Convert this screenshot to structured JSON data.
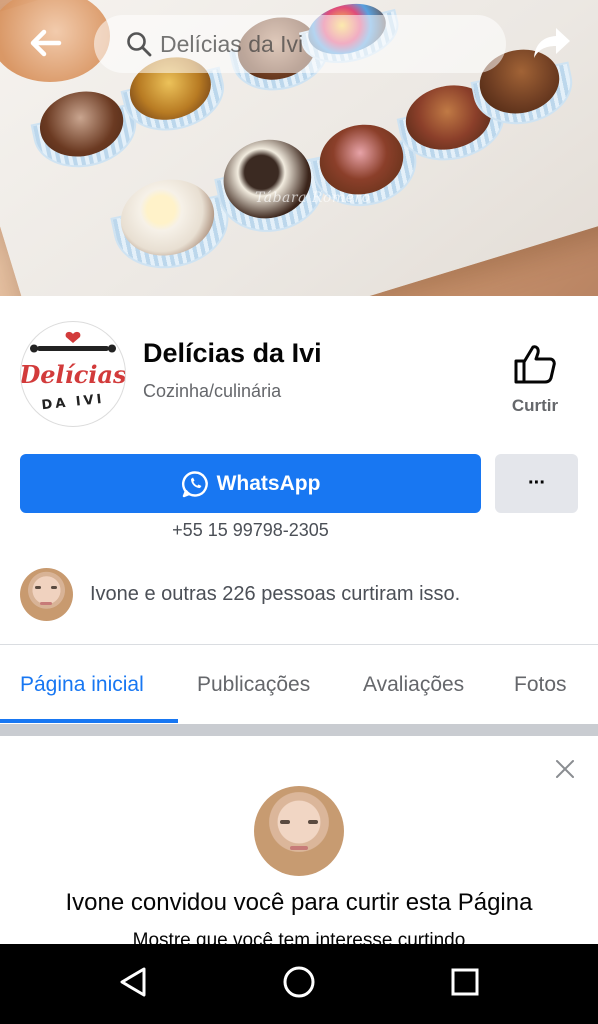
{
  "search": {
    "placeholder": "Delícias da Ivi"
  },
  "cover": {
    "watermark": "Tábara Romero"
  },
  "page": {
    "logo_text": "Delícias",
    "logo_subtext": "DA IVI",
    "name": "Delícias da Ivi",
    "category": "Cozinha/culinária"
  },
  "actions": {
    "like_label": "Curtir",
    "whatsapp_label": "WhatsApp",
    "more_label": "···",
    "phone": "+55 15 99798-2305"
  },
  "likes": {
    "text": "Ivone e outras 226 pessoas curtiram isso."
  },
  "tabs": [
    {
      "label": "Página inicial",
      "active": true
    },
    {
      "label": "Publicações",
      "active": false
    },
    {
      "label": "Avaliações",
      "active": false
    },
    {
      "label": "Fotos",
      "active": false
    }
  ],
  "invite": {
    "title": "Ivone convidou você para curtir esta Página",
    "subtitle": "Mostre que você tem interesse curtindo"
  },
  "colors": {
    "accent": "#1877f2",
    "secondary_text": "#65676b",
    "logo_red": "#d23b3b"
  },
  "icons": [
    "back-arrow-icon",
    "search-icon",
    "share-icon",
    "thumbs-up-icon",
    "whatsapp-icon",
    "close-icon",
    "nav-back-icon",
    "nav-home-icon",
    "nav-recents-icon"
  ]
}
